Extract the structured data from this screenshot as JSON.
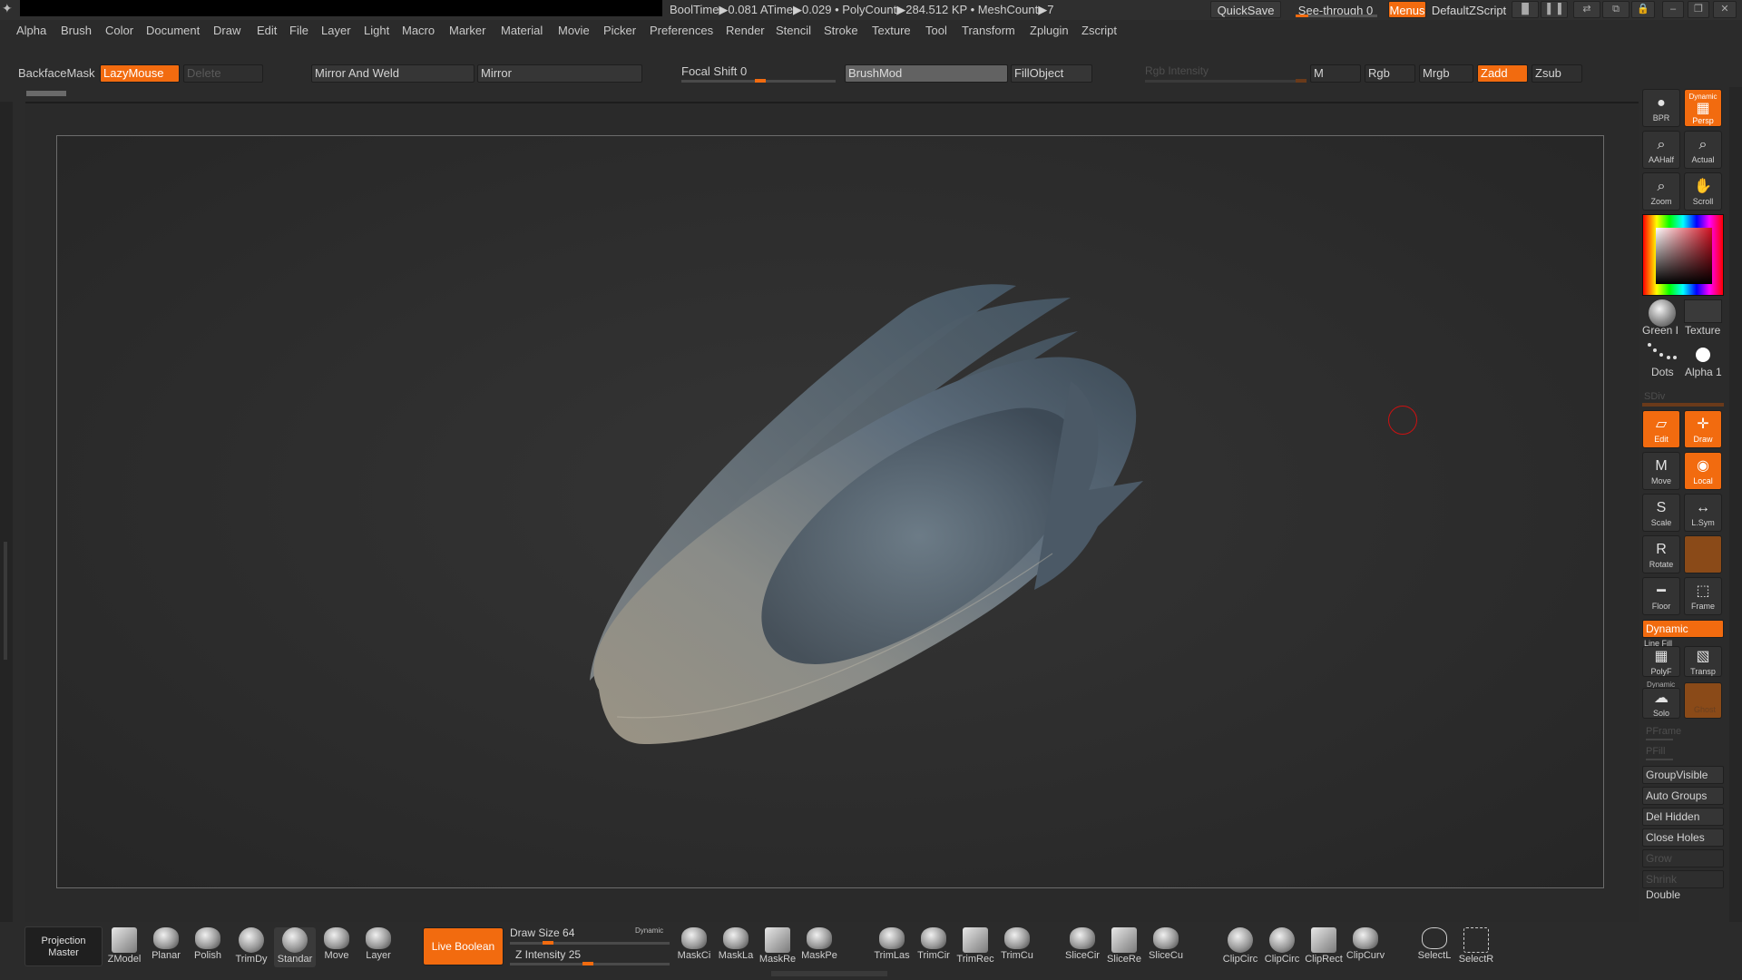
{
  "titlebar": {
    "stats": "BoolTime▶0.081 ATime▶0.029 • PolyCount▶284.512 KP • MeshCount▶7",
    "quicksave": "QuickSave",
    "seethrough": "See-through 0",
    "seethrough_value": 0.0,
    "menus": "Menus",
    "defaultzscript": "DefaultZScript"
  },
  "menu": [
    "Alpha",
    "Brush",
    "Color",
    "Document",
    "Draw",
    "Edit",
    "File",
    "Layer",
    "Light",
    "Macro",
    "Marker",
    "Material",
    "Movie",
    "Picker",
    "Preferences",
    "Render",
    "Stencil",
    "Stroke",
    "Texture",
    "Tool",
    "Transform",
    "Zplugin",
    "Zscript"
  ],
  "toolbar": {
    "backface": "BackfaceMask",
    "lazymouse": "LazyMouse",
    "delete": "Delete",
    "mirror_weld": "Mirror And Weld",
    "mirror": "Mirror",
    "focal_shift": "Focal Shift 0",
    "brushmod": "BrushMod",
    "fillobject": "FillObject",
    "rgb_intensity": "Rgb Intensity",
    "m": "M",
    "rgb": "Rgb",
    "mrgb": "Mrgb",
    "zadd": "Zadd",
    "zsub": "Zsub"
  },
  "shelf": {
    "bpr": "BPR",
    "persp_top": "Dynamic",
    "persp": "Persp",
    "aahalf": "AAHalf",
    "actual": "Actual",
    "zoom": "Zoom",
    "scroll": "Scroll",
    "material": "Green I",
    "texture": "Texture",
    "stroke": "Dots",
    "alpha": "Alpha 1",
    "sdiv": "SDiv",
    "edit": "Edit",
    "draw": "Draw",
    "move": "Move",
    "local": "Local",
    "scale": "Scale",
    "lsym": "L.Sym",
    "rotate": "Rotate",
    "floor": "Floor",
    "frame": "Frame",
    "dynamic": "Dynamic",
    "linefill": "Line Fill",
    "polyf": "PolyF",
    "transp": "Transp",
    "solo_top": "Dynamic",
    "solo": "Solo",
    "ghost": "Ghost",
    "pframe": "PFrame",
    "pfill": "PFill",
    "groupvisible": "GroupVisible",
    "autogroups": "Auto Groups",
    "delhidden": "Del Hidden",
    "closeholes": "Close Holes",
    "grow": "Grow",
    "shrink": "Shrink",
    "double": "Double"
  },
  "bottom": {
    "projection": [
      "Projection",
      "Master"
    ],
    "tools": [
      "ZModel",
      "Planar",
      "Polish",
      "TrimDy",
      "Standar",
      "Move",
      "Layer"
    ],
    "live_boolean": "Live Boolean",
    "draw_size": "Draw Size 64",
    "draw_size_dynamic": "Dynamic",
    "z_intensity": "Z Intensity 25",
    "masks": [
      "MaskCi",
      "MaskLa",
      "MaskRe",
      "MaskPe"
    ],
    "trims": [
      "TrimLas",
      "TrimCir",
      "TrimRec",
      "TrimCu"
    ],
    "slices": [
      "SliceCir",
      "SliceRe",
      "SliceCu"
    ],
    "clips": [
      "ClipCirc",
      "ClipCirc",
      "ClipRect",
      "ClipCurv"
    ],
    "selects": [
      "SelectL",
      "SelectR"
    ]
  },
  "colors": {
    "accent": "#f26b0f",
    "bg": "#2b2b2b"
  }
}
